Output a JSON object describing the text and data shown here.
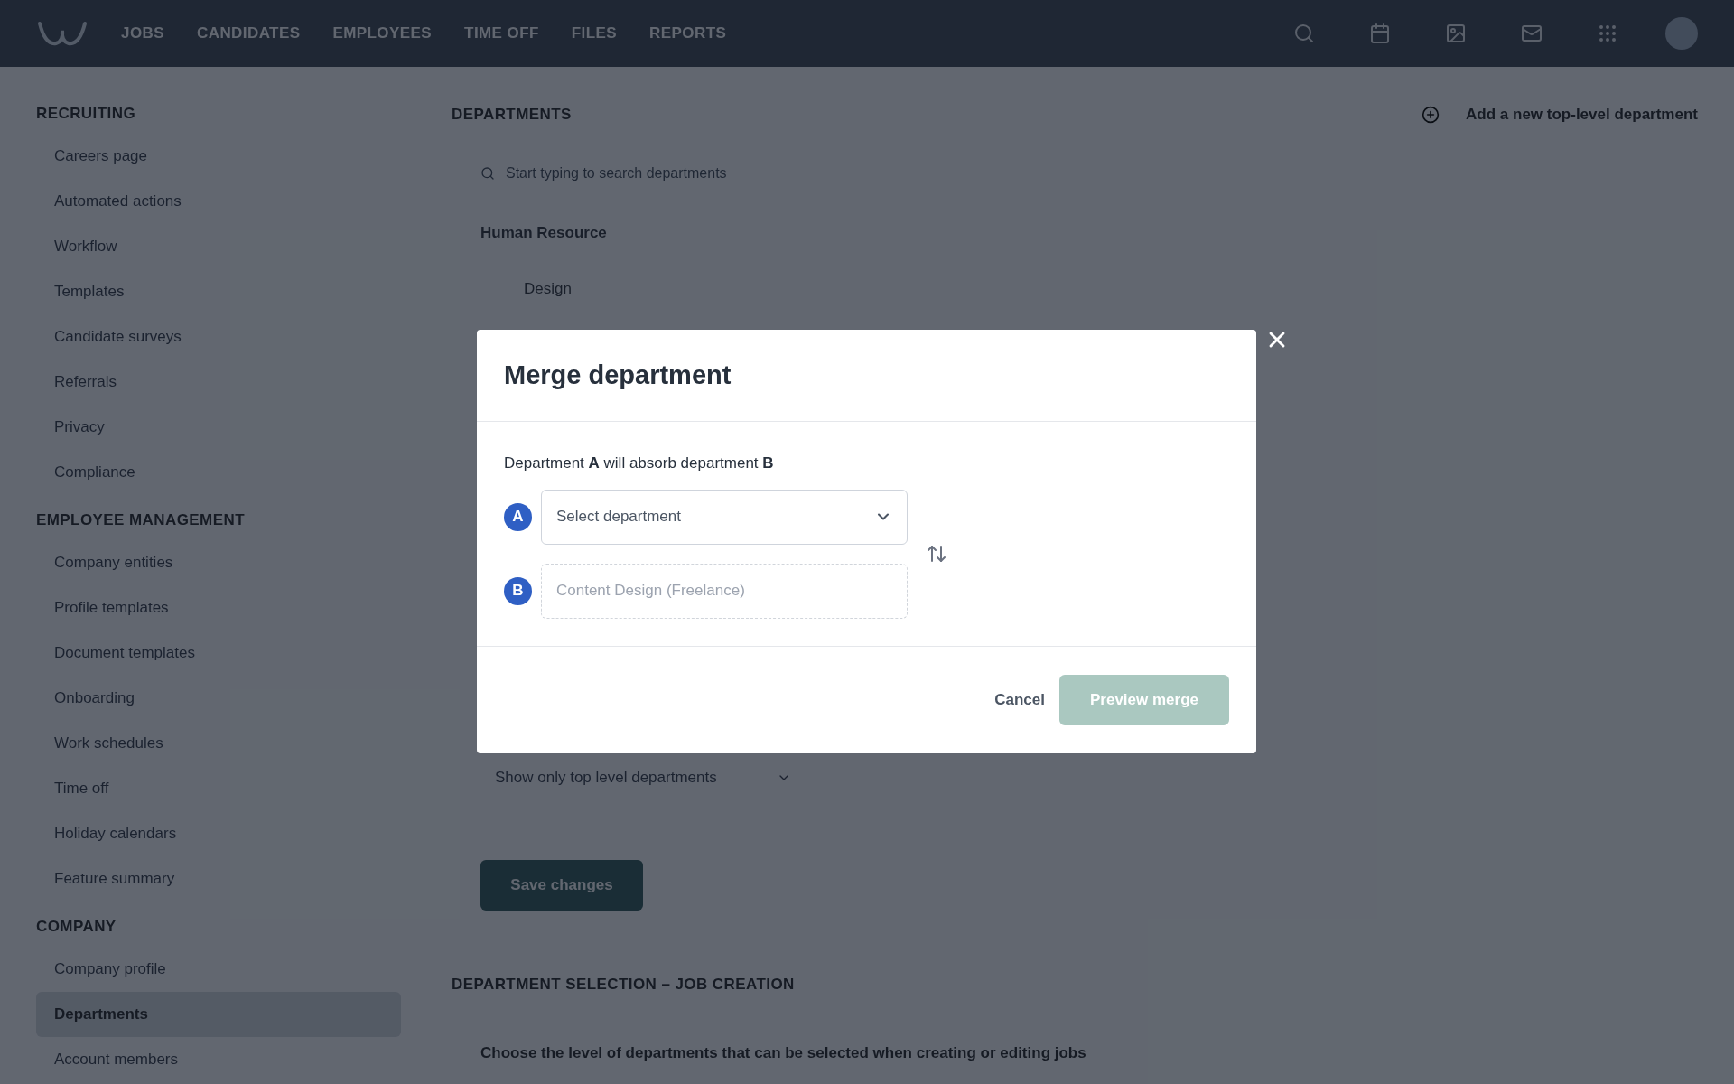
{
  "nav": {
    "items": [
      "JOBS",
      "CANDIDATES",
      "EMPLOYEES",
      "TIME OFF",
      "FILES",
      "REPORTS"
    ]
  },
  "sidebar": {
    "sections": [
      {
        "title": "RECRUITING",
        "items": [
          {
            "label": "Careers page",
            "selected": false
          },
          {
            "label": "Automated actions",
            "selected": false
          },
          {
            "label": "Workflow",
            "selected": false
          },
          {
            "label": "Templates",
            "selected": false
          },
          {
            "label": "Candidate surveys",
            "selected": false
          },
          {
            "label": "Referrals",
            "selected": false
          },
          {
            "label": "Privacy",
            "selected": false
          },
          {
            "label": "Compliance",
            "selected": false
          }
        ]
      },
      {
        "title": "EMPLOYEE MANAGEMENT",
        "items": [
          {
            "label": "Company entities",
            "selected": false
          },
          {
            "label": "Profile templates",
            "selected": false
          },
          {
            "label": "Document templates",
            "selected": false
          },
          {
            "label": "Onboarding",
            "selected": false
          },
          {
            "label": "Work schedules",
            "selected": false
          },
          {
            "label": "Time off",
            "selected": false
          },
          {
            "label": "Holiday calendars",
            "selected": false
          },
          {
            "label": "Feature summary",
            "selected": false
          }
        ]
      },
      {
        "title": "COMPANY",
        "items": [
          {
            "label": "Company profile",
            "selected": false
          },
          {
            "label": "Departments",
            "selected": true
          },
          {
            "label": "Account members",
            "selected": false
          }
        ]
      }
    ]
  },
  "main": {
    "heading": "DEPARTMENTS",
    "add_link": "Add a new top-level department",
    "search": {
      "placeholder": "Start typing to search departments"
    },
    "tree": [
      {
        "label": "Human Resource",
        "children": [
          {
            "label": "Design"
          }
        ]
      }
    ],
    "level_select": "Show only top level departments",
    "save_button": "Save changes",
    "section2_heading": "DEPARTMENT SELECTION – JOB CREATION",
    "section2_text": "Choose the level of departments that can be selected when creating or editing jobs"
  },
  "modal": {
    "title": "Merge department",
    "description": "Department **A** will absorb department **B**",
    "fields": [
      {
        "badge": "A",
        "kind": "select",
        "placeholder": "Select department",
        "disabled": false
      },
      {
        "badge": "B",
        "kind": "text",
        "value": "Content Design (Freelance)",
        "disabled": true
      }
    ],
    "cancel": "Cancel",
    "confirm": {
      "label": "Preview merge",
      "disabled": true
    }
  }
}
